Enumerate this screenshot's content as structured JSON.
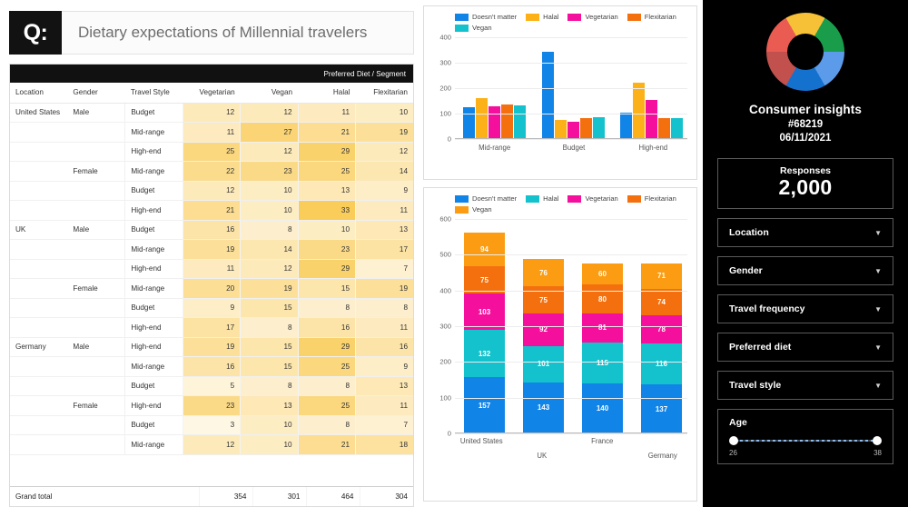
{
  "question": {
    "badge": "Q:",
    "title": "Dietary expectations of Millennial travelers"
  },
  "pivot": {
    "banner": "Preferred Diet / Segment",
    "columns": [
      "Location",
      "Gender",
      "Travel Style",
      "Vegetarian",
      "Vegan",
      "Halal",
      "Flexitarian"
    ],
    "rows": [
      {
        "location": "United States",
        "gender": "Male",
        "style": "Budget",
        "vegetarian": 12,
        "vegan": 12,
        "halal": 11,
        "flexitarian": 10,
        "group_start": true,
        "sub_start": true
      },
      {
        "location": "",
        "gender": "",
        "style": "Mid-range",
        "vegetarian": 11,
        "vegan": 27,
        "halal": 21,
        "flexitarian": 19,
        "group_start": false,
        "sub_start": false
      },
      {
        "location": "",
        "gender": "",
        "style": "High-end",
        "vegetarian": 25,
        "vegan": 12,
        "halal": 29,
        "flexitarian": 12,
        "group_start": false,
        "sub_start": false
      },
      {
        "location": "",
        "gender": "Female",
        "style": "Mid-range",
        "vegetarian": 22,
        "vegan": 23,
        "halal": 25,
        "flexitarian": 14,
        "group_start": false,
        "sub_start": true
      },
      {
        "location": "",
        "gender": "",
        "style": "Budget",
        "vegetarian": 12,
        "vegan": 10,
        "halal": 13,
        "flexitarian": 9,
        "group_start": false,
        "sub_start": false
      },
      {
        "location": "",
        "gender": "",
        "style": "High-end",
        "vegetarian": 21,
        "vegan": 10,
        "halal": 33,
        "flexitarian": 11,
        "group_start": false,
        "sub_start": false
      },
      {
        "location": "UK",
        "gender": "Male",
        "style": "Budget",
        "vegetarian": 16,
        "vegan": 8,
        "halal": 10,
        "flexitarian": 13,
        "group_start": true,
        "sub_start": true
      },
      {
        "location": "",
        "gender": "",
        "style": "Mid-range",
        "vegetarian": 19,
        "vegan": 14,
        "halal": 23,
        "flexitarian": 17,
        "group_start": false,
        "sub_start": false
      },
      {
        "location": "",
        "gender": "",
        "style": "High-end",
        "vegetarian": 11,
        "vegan": 12,
        "halal": 29,
        "flexitarian": 7,
        "group_start": false,
        "sub_start": false
      },
      {
        "location": "",
        "gender": "Female",
        "style": "Mid-range",
        "vegetarian": 20,
        "vegan": 19,
        "halal": 15,
        "flexitarian": 19,
        "group_start": false,
        "sub_start": true
      },
      {
        "location": "",
        "gender": "",
        "style": "Budget",
        "vegetarian": 9,
        "vegan": 15,
        "halal": 8,
        "flexitarian": 8,
        "group_start": false,
        "sub_start": false
      },
      {
        "location": "",
        "gender": "",
        "style": "High-end",
        "vegetarian": 17,
        "vegan": 8,
        "halal": 16,
        "flexitarian": 11,
        "group_start": false,
        "sub_start": false
      },
      {
        "location": "Germany",
        "gender": "Male",
        "style": "High-end",
        "vegetarian": 19,
        "vegan": 15,
        "halal": 29,
        "flexitarian": 16,
        "group_start": true,
        "sub_start": true
      },
      {
        "location": "",
        "gender": "",
        "style": "Mid-range",
        "vegetarian": 16,
        "vegan": 15,
        "halal": 25,
        "flexitarian": 9,
        "group_start": false,
        "sub_start": false
      },
      {
        "location": "",
        "gender": "",
        "style": "Budget",
        "vegetarian": 5,
        "vegan": 8,
        "halal": 8,
        "flexitarian": 13,
        "group_start": false,
        "sub_start": false
      },
      {
        "location": "",
        "gender": "Female",
        "style": "High-end",
        "vegetarian": 23,
        "vegan": 13,
        "halal": 25,
        "flexitarian": 11,
        "group_start": false,
        "sub_start": true
      },
      {
        "location": "",
        "gender": "",
        "style": "Budget",
        "vegetarian": 3,
        "vegan": 10,
        "halal": 8,
        "flexitarian": 7,
        "group_start": false,
        "sub_start": false
      },
      {
        "location": "",
        "gender": "",
        "style": "Mid-range",
        "vegetarian": 12,
        "vegan": 10,
        "halal": 21,
        "flexitarian": 18,
        "group_start": false,
        "sub_start": false
      }
    ],
    "total": {
      "label": "Grand total",
      "vegetarian": 354,
      "vegan": 301,
      "halal": 464,
      "flexitarian": 304
    }
  },
  "chart_data": [
    {
      "type": "bar",
      "id": "diet-by-travel-style",
      "title": "",
      "xlabel": "",
      "ylabel": "",
      "categories": [
        "Mid-range",
        "Budget",
        "High-end"
      ],
      "ylim": [
        0,
        400
      ],
      "yticks": [
        0,
        100,
        200,
        300,
        400
      ],
      "grid": true,
      "legend_position": "top",
      "series": [
        {
          "name": "Doesn't matter",
          "color": "#1184e8",
          "values": [
            124,
            343,
            103
          ]
        },
        {
          "name": "Halal",
          "color": "#fbb117",
          "values": [
            160,
            76,
            223
          ]
        },
        {
          "name": "Vegetarian",
          "color": "#f40f9c",
          "values": [
            128,
            69,
            155
          ]
        },
        {
          "name": "Flexitarian",
          "color": "#f4700f",
          "values": [
            136,
            83,
            81
          ]
        },
        {
          "name": "Vegan",
          "color": "#13c2cd",
          "values": [
            131,
            86,
            81
          ]
        }
      ]
    },
    {
      "type": "bar",
      "id": "diet-by-country-stacked",
      "stacked": true,
      "title": "",
      "xlabel": "",
      "ylabel": "",
      "categories": [
        "United States",
        "UK",
        "France",
        "Germany"
      ],
      "ylim": [
        0,
        600
      ],
      "yticks": [
        0,
        100,
        200,
        300,
        400,
        500,
        600
      ],
      "grid": true,
      "legend_position": "top",
      "series": [
        {
          "name": "Doesn't matter",
          "color": "#1184e8",
          "values": [
            157,
            143,
            140,
            137
          ]
        },
        {
          "name": "Halal",
          "color": "#13c2cd",
          "values": [
            132,
            101,
            115,
            116
          ]
        },
        {
          "name": "Vegetarian",
          "color": "#f40f9c",
          "values": [
            103,
            92,
            81,
            78
          ]
        },
        {
          "name": "Flexitarian",
          "color": "#f4700f",
          "values": [
            75,
            75,
            80,
            74
          ]
        },
        {
          "name": "Vegan",
          "color": "#fb9c12",
          "values": [
            94,
            76,
            60,
            71
          ]
        }
      ]
    }
  ],
  "sidebar": {
    "brand_name": "Consumer insights",
    "brand_id": "#68219",
    "brand_date": "06/11/2021",
    "logo_icon": "donut-chart-icon",
    "logo_colors": [
      "#ea5b52",
      "#f7c137",
      "#1a9d4b",
      "#5b9bea",
      "#1471cd",
      "#c2504c"
    ],
    "kpi": {
      "label": "Responses",
      "value": "2,000"
    },
    "filters": [
      {
        "label": "Location",
        "icon": "chevron-down-icon"
      },
      {
        "label": "Gender",
        "icon": "chevron-down-icon"
      },
      {
        "label": "Travel frequency",
        "icon": "chevron-down-icon"
      },
      {
        "label": "Preferred diet",
        "icon": "chevron-down-icon"
      },
      {
        "label": "Travel style",
        "icon": "chevron-down-icon"
      }
    ],
    "slider": {
      "label": "Age",
      "min": "26",
      "max": "38"
    }
  }
}
